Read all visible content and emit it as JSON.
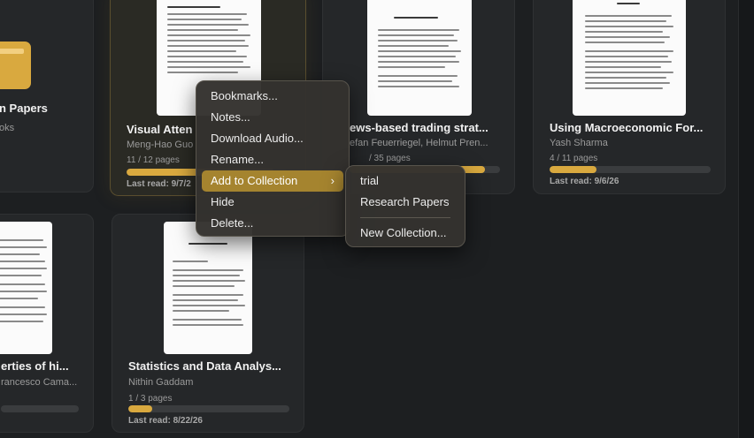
{
  "cards": [
    {
      "id": "research-papers",
      "title": "n Papers",
      "author": "oks",
      "pages": "",
      "progress": 0,
      "last_read": ""
    },
    {
      "id": "visual-attention",
      "title": "Visual Atten",
      "author": "Meng-Hao Guo",
      "pages": "11 / 12 pages",
      "progress": 0.92,
      "last_read": "Last read: 9/7/2"
    },
    {
      "id": "news-trading",
      "title": "ews-based trading strat...",
      "author": "efan Feuerriegel, Helmut Pren...",
      "pages": "/ 35 pages",
      "progress": 0.9,
      "last_read": ""
    },
    {
      "id": "macroeconomic",
      "title": "Using Macroeconomic For...",
      "author": "Yash Sharma",
      "pages": "4 / 11 pages",
      "progress": 0.29,
      "last_read": "Last read: 9/6/26"
    },
    {
      "id": "properties",
      "title": "erties of hi...",
      "author": "rancesco Cama...",
      "pages": "",
      "progress": 0,
      "last_read": ""
    },
    {
      "id": "statistics",
      "title": "Statistics and Data Analys...",
      "author": "Nithin Gaddam",
      "pages": "1 / 3 pages",
      "progress": 0.15,
      "last_read": "Last read: 8/22/26"
    }
  ],
  "context_menu": {
    "items": [
      {
        "label": "Bookmarks...",
        "active": false
      },
      {
        "label": "Notes...",
        "active": false
      },
      {
        "label": "Download Audio...",
        "active": false
      },
      {
        "label": "Rename...",
        "active": false
      },
      {
        "label": "Add to Collection",
        "active": true,
        "submenu": true
      },
      {
        "label": "Hide",
        "active": false
      },
      {
        "label": "Delete...",
        "active": false
      }
    ],
    "chevron": "›"
  },
  "submenu": {
    "collections": [
      "trial",
      "Research Papers"
    ],
    "new_collection": "New Collection..."
  },
  "colors": {
    "accent": "#d9a93f",
    "menu_highlight": "#a5842f",
    "background": "#1d1f21"
  }
}
